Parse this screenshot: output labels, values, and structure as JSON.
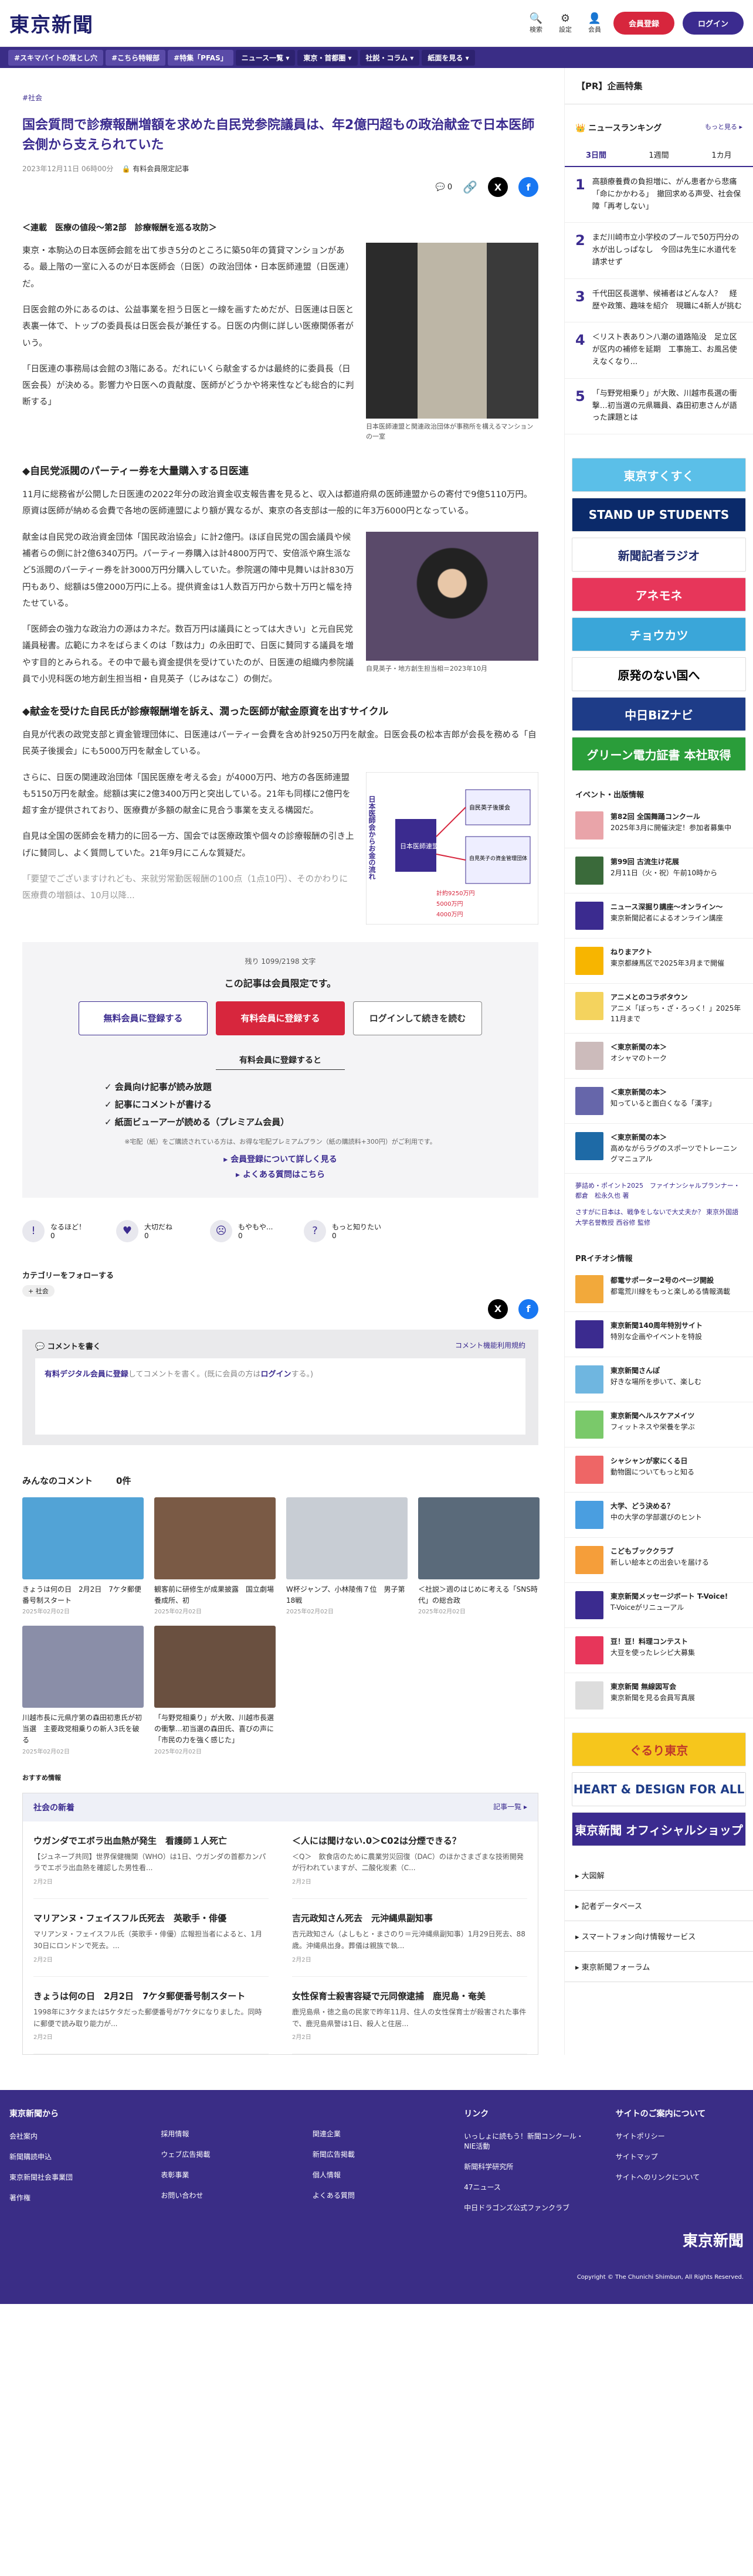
{
  "header": {
    "logo": "東京新聞",
    "icons": [
      {
        "glyph": "🔍",
        "label": "検索"
      },
      {
        "glyph": "⚙",
        "label": "設定"
      },
      {
        "glyph": "👤",
        "label": "会員"
      }
    ],
    "register": "会員登録",
    "login": "ログイン"
  },
  "nav": [
    {
      "label": "#スキマバイトの落とし穴",
      "kind": "tag"
    },
    {
      "label": "#こちら特報部",
      "kind": "tag"
    },
    {
      "label": "#特集「PFAS」",
      "kind": "tag"
    },
    {
      "label": "ニュース一覧 ▾",
      "kind": "dd"
    },
    {
      "label": "東京・首都圏 ▾",
      "kind": "dd"
    },
    {
      "label": "社説・コラム ▾",
      "kind": "dd"
    },
    {
      "label": "紙面を見る ▾",
      "kind": "dd"
    }
  ],
  "article": {
    "category": "#社会",
    "title": "国会質問で診療報酬増額を求めた自民党参院議員は、年2億円超もの政治献金で日本医師会側から支えられていた",
    "date": "2023年12月11日 06時00分",
    "label": "有料会員限定記事",
    "comment_count": "0",
    "series": "＜連載　医療の値段〜第2部　診療報酬を巡る攻防＞",
    "paras": [
      "東京・本駒込の日本医師会館を出て歩き5分のところに築50年の賃貸マンションがある。最上階の一室に入るのが日本医師会（日医）の政治団体・日本医師連盟（日医連）だ。",
      "日医会館の外にあるのは、公益事業を担う日医と一線を画すためだが、日医連は日医と表裏一体で、トップの委員長は日医会長が兼任する。日医の内側に詳しい医療関係者がいう。",
      "「日医連の事務局は会館の3階にある。だれにいくら献金するかは最終的に委員長（日医会長）が決める。影響力や日医への貢献度、医師がどうかや将来性なども総合的に判断する」"
    ],
    "photo1_cap": "日本医師連盟と関連政治団体が事務所を構えるマンションの一室",
    "h_party": "◆自民党派閥のパーティー券を大量購入する日医連",
    "paras2": [
      "11月に総務省が公開した日医連の2022年分の政治資金収支報告書を見ると、収入は都道府県の医師連盟からの寄付で9億5110万円。原資は医師が納める会費で各地の医師連盟により額が異なるが、東京の各支部は一般的に年3万6000円となっている。",
      "献金は自民党の政治資金団体「国民政治協会」に計2億円。ほぼ自民党の国会議員や候補者らの側に計2億6340万円。パーティー券購入は計4800万円で、安倍派や麻生派など5派閥のパーティー券を計3000万円分購入していた。参院選の陣中見舞いは計830万円もあり、総額は5億2000万円に上る。提供資金は1人数百万円から数十万円と幅を持たせている。",
      "「医師会の強力な政治力の源はカネだ。数百万円は議員にとっては大きい」と元自民党議員秘書。広範にカネをばらまくのは「数は力」の永田町で、日医に賛同する議員を増やす目的とみられる。その中で最も資金提供を受けていたのが、日医連の組織内参院議員で小児科医の地方創生担当相・自見英子（じみはなこ）の側だ。"
    ],
    "photo2_cap": "自見英子・地方創生担当相＝2023年10月",
    "h_donation": "◆献金を受けた自民氏が診療報酬増を訴え、潤った医師が献金原資を出すサイクル",
    "paras3": [
      "自見が代表の政党支部と資金管理団体に、日医連はパーティー会費を含め計9250万円を献金。日医会長の松本吉郎が会長を務める「自民英子後援会」にも5000万円を献金している。",
      "さらに、日医の関連政治団体「国民医療を考える会」が4000万円、地方の各医師連盟も5150万円を献金。総額は実に2億3400万円と突出している。21年も同様に2億円を超す金が提供されており、医療費が多額の献金に見合う事業を支える構図だ。",
      "自見は全国の医師会を精力的に回る一方、国会では医療政策や個々の診療報酬の引き上げに賛同し、よく質問していた。21年9月にこんな質疑だ。",
      "「要望でございますけれども、来就労常勤医報酬の100点（1点10円）、そのかわりに医療費の増額は、10月以降..."
    ],
    "diagram_labels": {
      "title": "日本医師会からお金の流れ",
      "left": "日本医師連盟",
      "right1": "自民英子後援会",
      "right2": "自見英子の資金管理団体",
      "amounts": [
        "計約9250万円",
        "5000万円",
        "4000万円"
      ]
    }
  },
  "paywall": {
    "remaining": "残り 1099/2198 文字",
    "msg": "この記事は会員限定です。",
    "free": "無料会員に登録する",
    "paid": "有料会員に登録する",
    "login": "ログインして続きを読む",
    "benefit_title": "有料会員に登録すると",
    "benefits": [
      "✓ 会員向け記事が読み放題",
      "✓ 記事にコメントが書ける",
      "✓ 紙面ビューアーが読める（プレミアム会員）"
    ],
    "note": "※宅配（紙）をご購読されている方は、お得な宅配プレミアムプラン（紙の購読料+300円）がご利用です。",
    "link1": "▸ 会員登録について詳しく見る",
    "link2": "▸ よくある質問はこちら"
  },
  "reactions": [
    {
      "glyph": "!",
      "label": "なるほど！",
      "count": "0"
    },
    {
      "glyph": "♥",
      "label": "大切だね",
      "count": "0"
    },
    {
      "glyph": "☹",
      "label": "もやもや...",
      "count": "0"
    },
    {
      "glyph": "?",
      "label": "もっと知りたい",
      "count": "0"
    }
  ],
  "follow": {
    "title": "カテゴリーをフォローする",
    "chip": "+ 社会"
  },
  "comment": {
    "head": "コメントを書く",
    "rule": "コメント機能利用規約",
    "prompt_a": "有料デジタル会員に登録",
    "prompt_b": "してコメントを書く。(既に会員の方は",
    "prompt_c": "ログイン",
    "prompt_d": "する。)"
  },
  "all_comments": {
    "title": "みんなのコメント",
    "count": "0件"
  },
  "thumbs": [
    {
      "title": "きょうは何の日　2月2日　7ケタ郵便番号制スタート",
      "date": "2025年02月02日",
      "bg": "#52a3d6"
    },
    {
      "title": "観客前に研修生が成果披露　国立劇場養成所、初",
      "date": "2025年02月02日",
      "bg": "#7a5a45"
    },
    {
      "title": "W杯ジャンプ、小林陵侑７位　男子第18戦",
      "date": "2025年02月02日",
      "bg": "#c8cdd4"
    },
    {
      "title": "＜社説＞週のはじめに考える「SNS時代」の総合政",
      "date": "2025年02月02日",
      "bg": "#5a6a7a"
    },
    {
      "title": "川越市長に元県庁第の森田初恵氏が初当選　主要政党相乗りの新人3氏を破る",
      "date": "2025年02月02日",
      "bg": "#8a8ea8"
    },
    {
      "title": "「与野党相乗り」が大敗、川越市長選の衝撃…初当選の森田氏、喜びの声に「市民の力を強く感じた」",
      "date": "2025年02月02日",
      "bg": "#6a5040"
    }
  ],
  "recommend": "おすすめ情報",
  "social": {
    "title": "社会の新着",
    "more": "記事一覧 ▸",
    "items": [
      {
        "t": "ウガンダでエボラ出血熱が発生　看護師１人死亡",
        "d": "【ジュネーブ共同】世界保健機関（WHO）は1日、ウガンダの首都カンパラでエボラ出血熱を確認した男性看...",
        "dt": "2月2日"
      },
      {
        "t": "＜人には聞けない.0＞C02は分煙できる？",
        "d": "＜Q＞　飲食店のために農業労災回復（DAC）のほかさまざまな技術開発が行われていますが、二酸化炭素（C...",
        "dt": "2月2日"
      },
      {
        "t": "マリアンヌ・フェイスフル氏死去　英歌手・俳優",
        "d": "マリアンヌ・フェイスフル氏（英歌手・俳優）広報担当者によると、1月30日にロンドンで死去。...",
        "dt": "2月2日"
      },
      {
        "t": "吉元政知さん死去　元沖縄県副知事",
        "d": "吉元政知さん（よしもと・まさのり＝元沖縄県副知事）1月29日死去、88歳。沖縄県出身。葬儀は親族で執...",
        "dt": "2月2日"
      },
      {
        "t": "きょうは何の日　2月2日　7ケタ郵便番号制スタート",
        "d": "1998年に3ケタまたは5ケタだった郵便番号が7ケタになりました。同時に郵便で読み取り能力が...",
        "dt": "2月2日"
      },
      {
        "t": "女性保育士殺害容疑で元同僚逮捕　鹿児島・奄美",
        "d": "鹿児島県・徳之島の民家で昨年11月、住人の女性保育士が殺害された事件で、鹿児島県警は1日、殺人と住居...",
        "dt": "2月2日"
      }
    ]
  },
  "sidebar": {
    "pr": "【PR】企画特集",
    "ranking": {
      "title": "ニュースランキング",
      "more": "もっと見る ▸",
      "tabs": [
        "3日間",
        "1週間",
        "1カ月"
      ],
      "items": [
        {
          "n": "1",
          "t": "高額療養費の負担増に、がん患者から悲痛「命にかかわる」　撤回求める声受、社会保障「再考しない」"
        },
        {
          "n": "2",
          "t": "まだ川崎市立小学校のプールで50万円分の水が出しっぱなし　今回は先生に水道代を請求せず"
        },
        {
          "n": "3",
          "t": "千代田区長選挙、候補者はどんな人？　経歴や政策、趣味を紹介　現職に4新人が挑む"
        },
        {
          "n": "4",
          "t": "＜リスト表あり＞八潮の道路陥没　足立区が区内の補修を延期　工事施工、お風呂使えなくなり..."
        },
        {
          "n": "5",
          "t": "「与野党相乗り」が大敗、川越市長選の衝撃…初当選の元県職員、森田初恵さんが語った課題とは"
        }
      ]
    },
    "banners": [
      {
        "text": "東京すくすく",
        "bg": "#5bbfe8",
        "fg": "#fff"
      },
      {
        "text": "STAND UP STUDENTS",
        "bg": "#0b2a6a",
        "fg": "#fff"
      },
      {
        "text": "新聞記者ラジオ",
        "bg": "#fff",
        "fg": "#1e2b6b"
      },
      {
        "text": "アネモネ",
        "bg": "#e7365a",
        "fg": "#fff"
      },
      {
        "text": "チョウカツ",
        "bg": "#3aa6d9",
        "fg": "#fff"
      },
      {
        "text": "原発のない国へ",
        "bg": "#fff",
        "fg": "#000"
      },
      {
        "text": "中日BiZナビ",
        "bg": "#1e3c88",
        "fg": "#fff"
      },
      {
        "text": "グリーン電力証書 本社取得",
        "bg": "#2a9d3a",
        "fg": "#fff"
      }
    ],
    "events_title": "イベント・出版情報",
    "events": [
      {
        "b": "第82回 全国舞踊コンクール",
        "t": "2025年3月に開催決定！参加者募集中",
        "bg": "#e9a4a9"
      },
      {
        "b": "第99回 古流生け花展",
        "t": "2月11日（火・祝）午前10時から",
        "bg": "#3a6a3a"
      },
      {
        "b": "ニュース深掘り講座〜オンライン〜",
        "t": "東京新聞記者によるオンライン講座",
        "bg": "#3b2b8f"
      },
      {
        "b": "ねりまアクト",
        "t": "東京都練馬区で2025年3月まで開催",
        "bg": "#f7b500"
      },
      {
        "b": "アニメとのコラボタウン",
        "t": "アニメ「ぼっち・ざ・ろっく！」2025年11月まで",
        "bg": "#f4d35e"
      },
      {
        "b": "＜東京新聞の本＞",
        "t": "オシャマのトーク",
        "bg": "#cbb"
      },
      {
        "b": "＜東京新聞の本＞",
        "t": "知っていると面白くなる「漢字」",
        "bg": "#66a"
      },
      {
        "b": "＜東京新聞の本＞",
        "t": "高めながらラグのスポーツでトレーニングマニュアル",
        "bg": "#1e6aa6"
      }
    ],
    "book_notes": [
      "夢詰め・ポイント2025　ファイナンシャルプランナー・都倉　松永久也 著",
      "さすがに日本は、戦争をしないで大丈夫か？ 東京外国語大学名誉教授 西谷修 監修"
    ],
    "pr_info_title": "PRイチオシ情報",
    "pr_info": [
      {
        "b": "都電サポーター2号のページ開設",
        "t": "都電荒川線をもっと楽しめる情報満載",
        "bg": "#f2a93b"
      },
      {
        "b": "東京新聞140周年特別サイト",
        "t": "特別な企画やイベントを特設",
        "bg": "#3b2b8f"
      },
      {
        "b": "東京新聞さんぽ",
        "t": "好きな場所を歩いて、楽しむ",
        "bg": "#6fb6e0"
      },
      {
        "b": "東京新聞ヘルスケアメイツ",
        "t": "フィットネスや栄養を学ぶ",
        "bg": "#7ac96a"
      },
      {
        "b": "シャシャンが家にくる日",
        "t": "動物園についてもっと知る",
        "bg": "#e66"
      },
      {
        "b": "大学、どう決める？",
        "t": "中の大学の学部選びのヒント",
        "bg": "#4a9ee0"
      },
      {
        "b": "こどもブッククラブ",
        "t": "新しい絵本との出会いを届ける",
        "bg": "#f59e3a"
      },
      {
        "b": "東京新聞メッセージボート T-Voice!",
        "t": "T-Voiceがリニューアル",
        "bg": "#3b2b8f"
      },
      {
        "b": "豆！豆！料理コンテスト",
        "t": "大豆を使ったレシピ大募集",
        "bg": "#e7365a"
      },
      {
        "b": "東京新聞 無線図写会",
        "t": "東京新聞を見る会員写真展",
        "bg": "#ddd"
      }
    ],
    "banners2": [
      {
        "text": "ぐるり東京",
        "bg": "#f6c61c",
        "fg": "#c0392b"
      },
      {
        "text": "HEART & DESIGN FOR ALL",
        "bg": "#fff",
        "fg": "#1e3c88"
      },
      {
        "text": "東京新聞 オフィシャルショップ",
        "bg": "#3b2b8f",
        "fg": "#fff"
      }
    ],
    "links": [
      "▸ 大図解",
      "▸ 記者データベース",
      "▸ スマートフォン向け情報サービス",
      "▸ 東京新聞フォーラム"
    ]
  },
  "footer": {
    "cols": [
      {
        "h": "東京新聞から",
        "items": [
          "会社案内",
          "新聞購読申込",
          "東京新聞社会事業団",
          "著作権"
        ]
      },
      {
        "h": "",
        "items": [
          "採用情報",
          "ウェブ広告掲載",
          "表彰事業",
          "お問い合わせ"
        ]
      },
      {
        "h": "",
        "items": [
          "関連企業",
          "新聞広告掲載",
          "個人情報",
          "よくある質問"
        ]
      },
      {
        "h": "リンク",
        "items": [
          "いっしょに読もう！新聞コンクール・NIE活動",
          "新聞科学研究所",
          "47ニュース",
          "中日ドラゴンズ公式ファンクラブ"
        ]
      },
      {
        "h": "サイトのご案内について",
        "items": [
          "サイトポリシー",
          "サイトマップ",
          "サイトへのリンクについて"
        ]
      }
    ],
    "logo": "東京新聞",
    "copyright": "Copyright © The Chunichi Shimbun, All Rights Reserved."
  }
}
